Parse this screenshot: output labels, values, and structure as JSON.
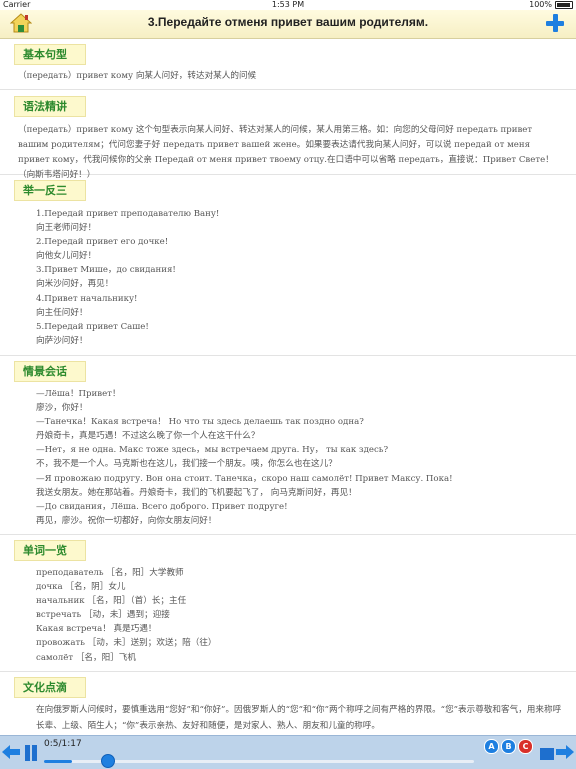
{
  "status": {
    "carrier": "Carrier",
    "time": "1:53 PM",
    "battery": "100%"
  },
  "nav": {
    "title": "3.Передайте отменя привет вашим родителям."
  },
  "sections": {
    "s1": {
      "title": "基本句型",
      "lines": [
        "（передать）привет кому 向某人问好，转达对某人的问候"
      ]
    },
    "s2": {
      "title": "语法精讲",
      "text": "（передать）привет кому 这个句型表示向某人问好、转达对某人的问候，某人用第三格。如：向您的父母问好 передать привет вашим родителям；代问您妻子好 передать привет вашей жене。如果要表达请代我向某人问好，可以说 передай от меня привет кому，代我问候你的父亲 Передай от меня привет твоему отцу.在口语中可以省略 передать，直接说：Привет Свете！ （向斯韦塔问好！）"
    },
    "s3": {
      "title": "举一反三",
      "lines": [
        "1.Передай привет преподавателю Вану!",
        "向王老师问好！",
        "2.Передай привет его дочке!",
        "向他女儿问好！",
        "3.Привет Мише，до свидания!",
        "向米沙问好，再见！",
        "4.Привет начальнику!",
        "向主任问好！",
        "5.Передай привет Саше!",
        "向萨沙问好！"
      ]
    },
    "s4": {
      "title": "情景会话",
      "lines": [
        "—Лёша！Привет！",
        "廖沙，你好！",
        "—Танечка！Какая встреча！ Но что ты здесь делаешь так поздно одна?",
        "丹娘奇卡，真是巧遇！不过这么晚了你一个人在这干什么？",
        "—Нет，я не одна. Макс тоже здесь，мы встречаем друга. Ну， ты как здесь?",
        "不，我不是一个人。马克斯也在这儿，我们接一个朋友。咦，你怎么也在这儿？",
        "—Я провожаю подругу. Вон она стоит. Танечка，скоро наш самолёт! Привет Максу. Пока!",
        "我送女朋友。她在那站着。丹娘奇卡，我们的飞机要起飞了， 向马克斯问好，再见！",
        "—До свидания，Лёша. Всего доброго. Привет подруге!",
        "再见，廖沙。祝你一切都好，向你女朋友问好！"
      ]
    },
    "s5": {
      "title": "单词一览",
      "lines": [
        "преподаватель ［名，阳］大学教师",
        "дочка ［名，阴］女儿",
        "начальник ［名，阳］（首）长；主任",
        "встречать ［动，未］遇到；迎接",
        "Какая встреча！ 真是巧遇！",
        "провожать ［动，未］送别；欢送；陪（往）",
        "самолёт ［名，阳］飞机"
      ]
    },
    "s6": {
      "title": "文化点滴",
      "text": "在向俄罗斯人问候时，要慎重选用“您好”和“你好”。因俄罗斯人的“您”和“你”两个称呼之间有严格的界限。“您”表示尊敬和客气，用来称呼长辈、上级、陌生人；“你”表示亲热、友好和随便，是对家人、熟人、朋友和儿童的称呼。"
    }
  },
  "player": {
    "time": "0:5/1:17",
    "progress": 0.065,
    "btn_a": "A",
    "btn_b": "B",
    "btn_c": "C"
  },
  "colors": {
    "accent": "#1e7fe0",
    "heading": "#2d8a2d",
    "heading_bg": "#fdf9cd",
    "bar": "#bdd3ea",
    "btn_c": "#d9302a"
  }
}
